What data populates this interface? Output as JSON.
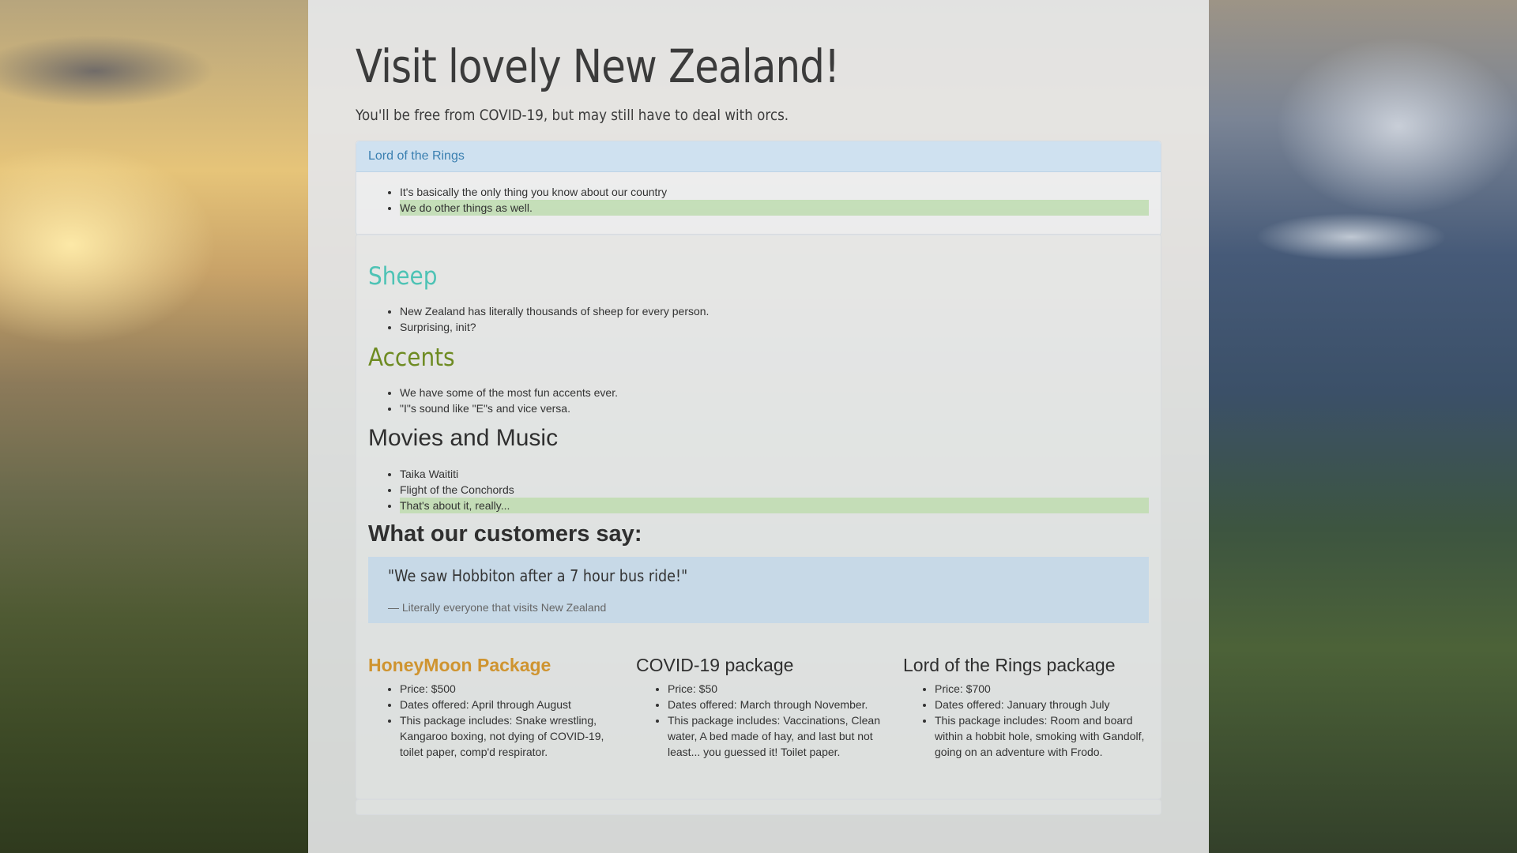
{
  "header": {
    "title": "Visit lovely New Zealand!",
    "subtitle": "You'll be free from COVID-19, but may still have to deal with orcs."
  },
  "lotr_panel": {
    "heading": "Lord of the Rings",
    "items": [
      "It's basically the only thing you know about our country",
      "We do other things as well."
    ]
  },
  "sections": {
    "sheep": {
      "title": "Sheep",
      "items": [
        "New Zealand has literally thousands of sheep for every person.",
        "Surprising, init?"
      ]
    },
    "accents": {
      "title": "Accents",
      "items": [
        "We have some of the most fun accents ever.",
        "\"I\"s sound like \"E\"s and vice versa."
      ]
    },
    "movies": {
      "title": "Movies and Music",
      "items": [
        "Taika Waititi",
        "Flight of the Conchords",
        "That's about it, really..."
      ]
    },
    "customers": {
      "title": "What our customers say:",
      "quote": "\"We saw Hobbiton after a 7 hour bus ride!\"",
      "cite": "— Literally everyone that visits New Zealand"
    }
  },
  "packages": [
    {
      "title": "HoneyMoon Package",
      "price": "Price: $500",
      "dates": "Dates offered: April through August",
      "includes": "This package includes: Snake wrestling, Kangaroo boxing, not dying of COVID-19, toilet paper, comp'd respirator."
    },
    {
      "title": "COVID-19 package",
      "price": "Price: $50",
      "dates": "Dates offered: March through November.",
      "includes": "This package includes: Vaccinations, Clean water, A bed made of hay, and last but not least... you guessed it! Toilet paper."
    },
    {
      "title": "Lord of the Rings package",
      "price": "Price: $700",
      "dates": "Dates offered: January through July",
      "includes": "This package includes: Room and board within a hobbit hole, smoking with Gandolf, going on an adventure with Frodo."
    }
  ],
  "colors": {
    "sheep": "#4ec3b5",
    "accents": "#6e8b22",
    "honeymoon": "#cf9430",
    "panel_heading": "#3a7fb0",
    "highlight": "#bedcaf",
    "quote_bg": "#c3d7e8"
  }
}
